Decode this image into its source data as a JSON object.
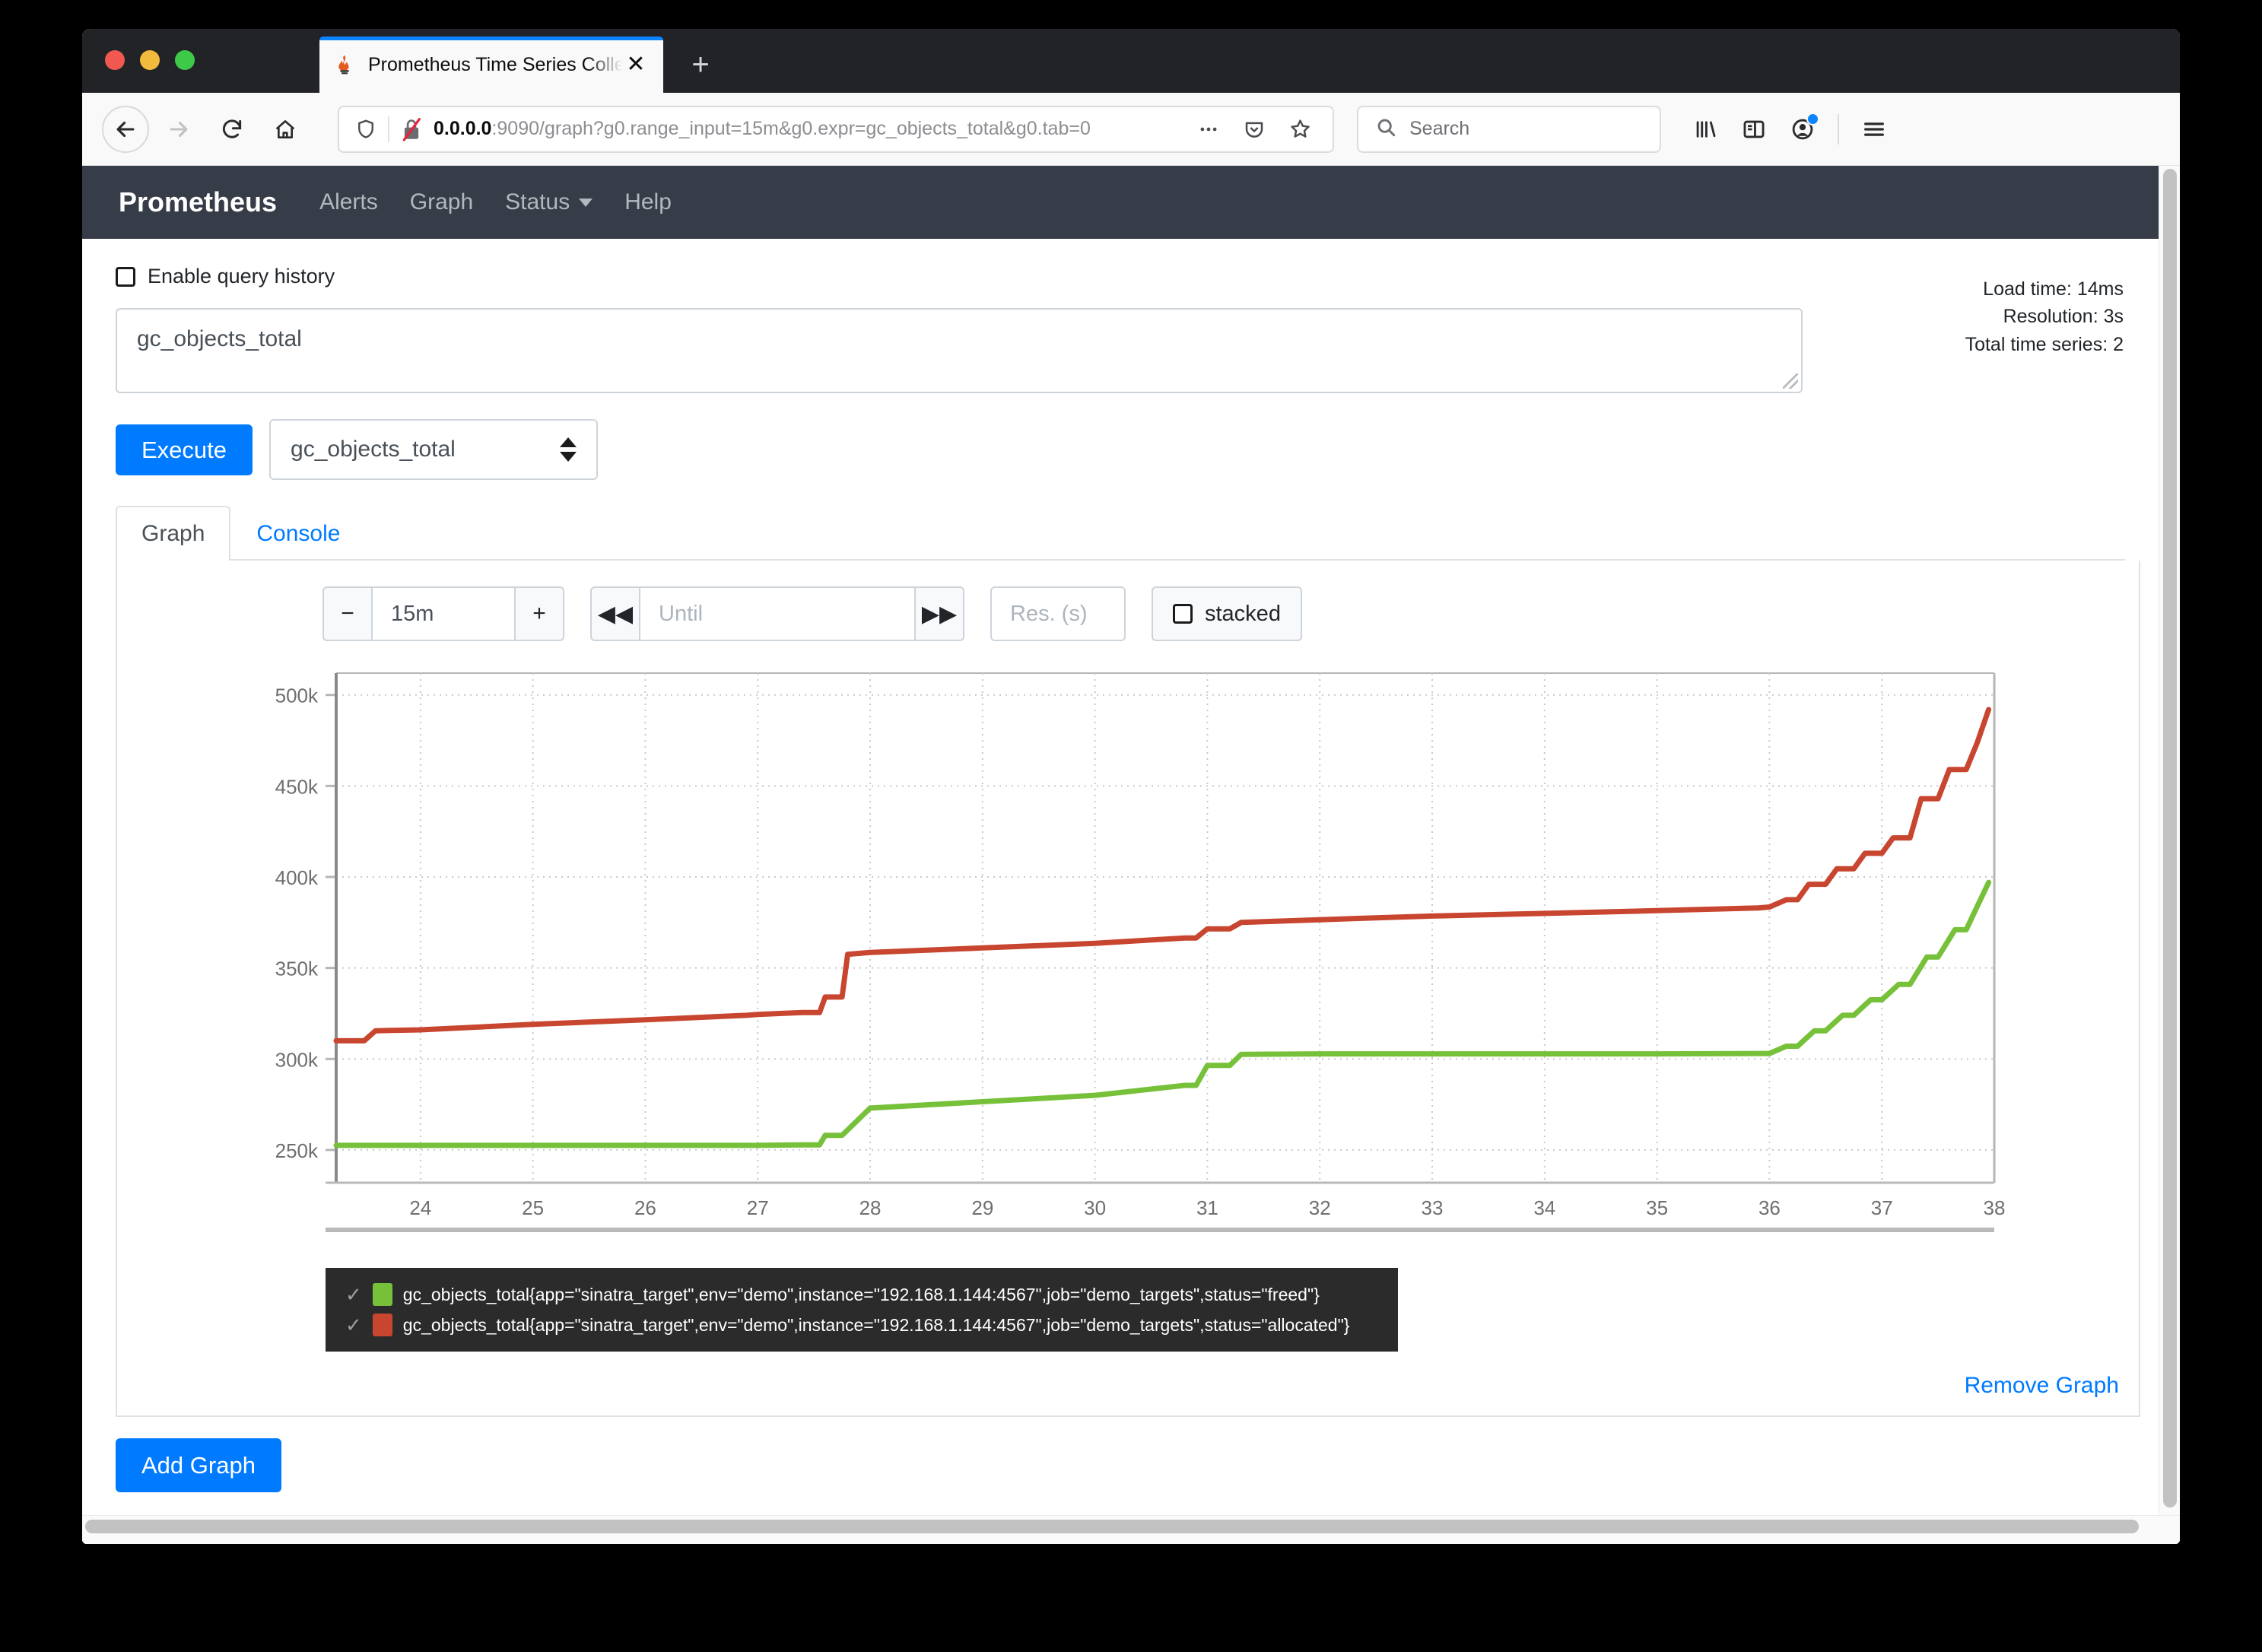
{
  "browser": {
    "tab": {
      "title": "Prometheus Time Series Collect",
      "favicon_icon": "prometheus-flame-icon",
      "close_icon": "close-icon"
    },
    "new_tab_icon": "plus-icon",
    "back_icon": "arrow-left-icon",
    "forward_icon": "arrow-right-icon",
    "reload_icon": "reload-icon",
    "home_icon": "home-icon",
    "url": {
      "host": "0.0.0.0",
      "rest": ":9090/graph?g0.range_input=15m&g0.expr=gc_objects_total&g0.tab=0"
    },
    "shield_icon": "shield-icon",
    "lock_broken_icon": "broken-lock-icon",
    "page_actions_icon": "ellipsis-icon",
    "pocket_icon": "pocket-icon",
    "bookmark_icon": "star-icon",
    "search": {
      "placeholder": "Search",
      "icon": "search-icon"
    },
    "toolbar_icons": [
      "library-icon",
      "sidebar-icon",
      "account-icon",
      "menu-icon"
    ]
  },
  "nav": {
    "brand": "Prometheus",
    "links": [
      "Alerts",
      "Graph",
      "Status",
      "Help"
    ],
    "status_caret_icon": "chevron-down-icon"
  },
  "query": {
    "history_label": "Enable query history",
    "history_checked": false,
    "expression": "gc_objects_total",
    "execute_label": "Execute",
    "metric_selected": "gc_objects_total",
    "select_arrows_icon": "sort-arrows-icon"
  },
  "stats": {
    "load_time": "Load time: 14ms",
    "resolution": "Resolution: 3s",
    "total_series": "Total time series: 2"
  },
  "tabs": [
    {
      "label": "Graph",
      "active": true
    },
    {
      "label": "Console",
      "active": false
    }
  ],
  "graph_controls": {
    "decrease_icon": "minus-icon",
    "range_value": "15m",
    "increase_icon": "plus-icon",
    "back_icon": "double-chevron-left-icon",
    "until_placeholder": "Until",
    "until_value": "",
    "forward_icon": "double-chevron-right-icon",
    "resolution_placeholder": "Res. (s)",
    "resolution_value": "",
    "stacked_label": "stacked",
    "stacked_checked": false
  },
  "legend": [
    {
      "color": "#77c13a",
      "check_icon": "check-icon",
      "label": "gc_objects_total{app=\"sinatra_target\",env=\"demo\",instance=\"192.168.1.144:4567\",job=\"demo_targets\",status=\"freed\"}"
    },
    {
      "color": "#c8452f",
      "check_icon": "check-icon",
      "label": "gc_objects_total{app=\"sinatra_target\",env=\"demo\",instance=\"192.168.1.144:4567\",job=\"demo_targets\",status=\"allocated\"}"
    }
  ],
  "actions": {
    "remove_graph": "Remove Graph",
    "add_graph": "Add Graph"
  },
  "chart_data": {
    "type": "line",
    "title": "",
    "xlabel": "",
    "ylabel": "",
    "grid": true,
    "legend_position": "below",
    "xlim": [
      23.25,
      38.0
    ],
    "ylim": [
      232000,
      512000
    ],
    "xticks": [
      24,
      25,
      26,
      27,
      28,
      29,
      30,
      31,
      32,
      33,
      34,
      35,
      36,
      37,
      38
    ],
    "yticks": [
      250000,
      300000,
      350000,
      400000,
      450000,
      500000
    ],
    "ytick_labels": [
      "250k",
      "300k",
      "350k",
      "400k",
      "450k",
      "500k"
    ],
    "series": [
      {
        "name": "gc_objects_total{status=\"allocated\"}",
        "color": "#c8452f",
        "x": [
          23.25,
          23.5,
          23.6,
          24.0,
          25.0,
          26.0,
          26.9,
          27.0,
          27.4,
          27.55,
          27.6,
          27.75,
          27.8,
          28.0,
          29.0,
          30.0,
          30.8,
          30.9,
          31.0,
          31.2,
          31.3,
          32.0,
          33.0,
          34.0,
          35.0,
          35.9,
          36.0,
          36.15,
          36.25,
          36.35,
          36.5,
          36.6,
          36.75,
          36.85,
          37.0,
          37.1,
          37.25,
          37.35,
          37.5,
          37.6,
          37.75,
          37.85,
          37.95
        ],
        "y": [
          310000,
          310000,
          315500,
          316000,
          319000,
          321500,
          324000,
          324500,
          325500,
          325500,
          334000,
          334000,
          357500,
          358500,
          361000,
          363500,
          366500,
          366500,
          371500,
          371500,
          375000,
          376500,
          378500,
          380000,
          381500,
          383000,
          383500,
          387500,
          387500,
          396000,
          396000,
          404500,
          404500,
          413000,
          413000,
          421500,
          421500,
          443000,
          443000,
          459000,
          459000,
          474000,
          492000
        ]
      },
      {
        "name": "gc_objects_total{status=\"freed\"}",
        "color": "#77c13a",
        "x": [
          23.25,
          24.0,
          25.0,
          26.0,
          27.0,
          27.4,
          27.55,
          27.6,
          27.75,
          28.0,
          29.0,
          30.0,
          30.8,
          30.9,
          31.0,
          31.2,
          31.3,
          32.0,
          33.0,
          34.0,
          35.0,
          35.9,
          36.0,
          36.15,
          36.25,
          36.4,
          36.5,
          36.65,
          36.75,
          36.9,
          37.0,
          37.15,
          37.25,
          37.4,
          37.5,
          37.65,
          37.75,
          37.85,
          37.95
        ],
        "y": [
          252500,
          252500,
          252500,
          252500,
          252500,
          252800,
          252800,
          258000,
          258000,
          273000,
          276500,
          280000,
          285500,
          285500,
          296500,
          296500,
          302500,
          302800,
          302800,
          302800,
          302800,
          303000,
          303000,
          307000,
          307000,
          315500,
          315500,
          324000,
          324000,
          332500,
          332500,
          341000,
          341000,
          356000,
          356000,
          371000,
          371000,
          384000,
          397000
        ]
      }
    ]
  }
}
